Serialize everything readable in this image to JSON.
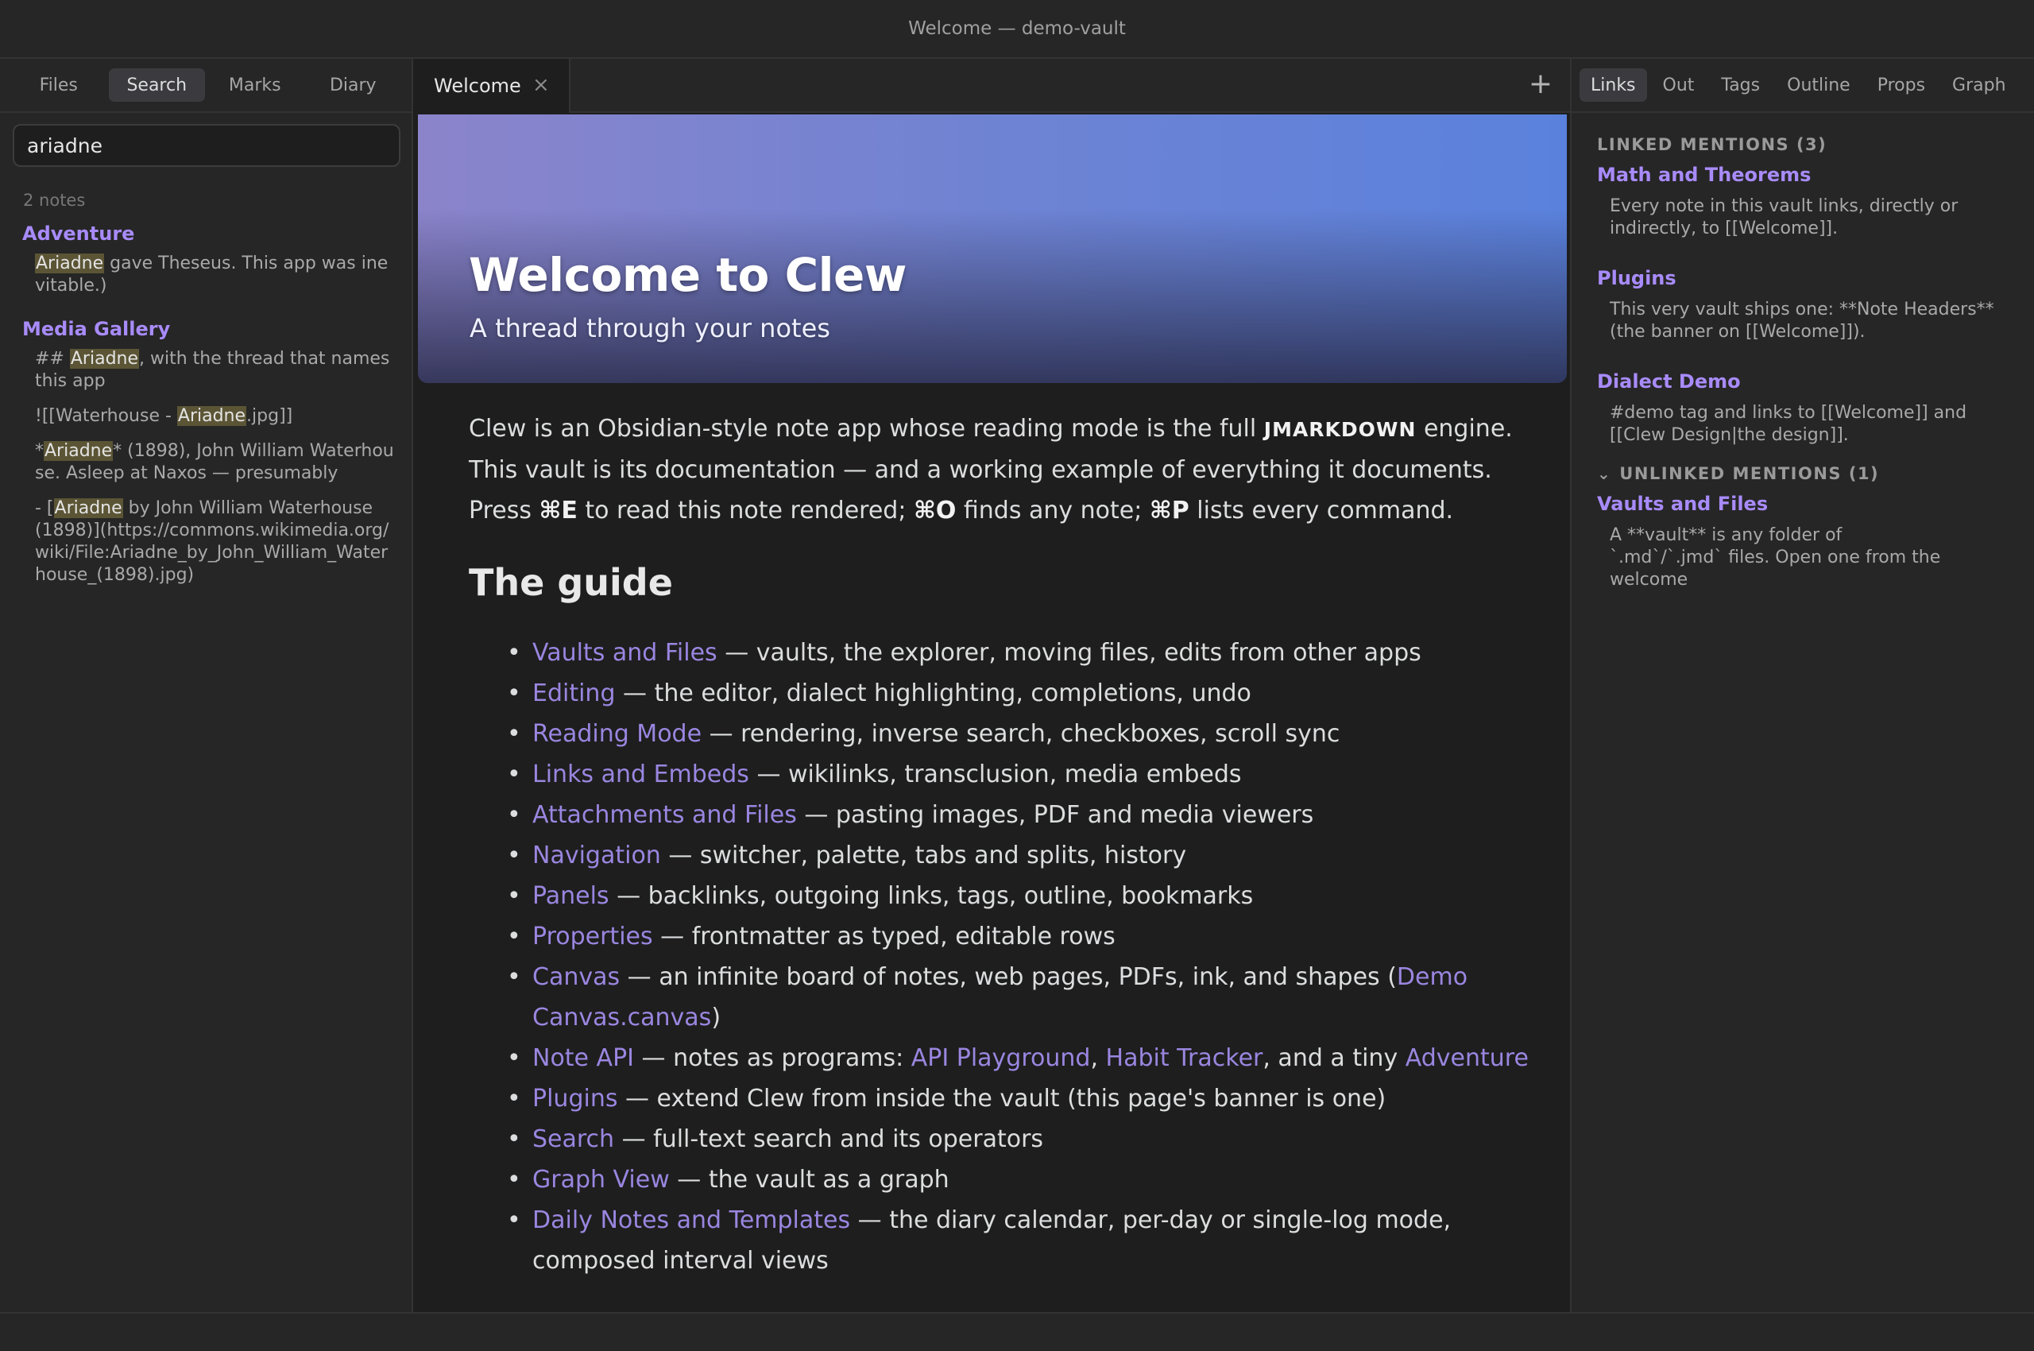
{
  "window": {
    "title": "Welcome — demo-vault"
  },
  "left_tabs": [
    "Files",
    "Search",
    "Marks",
    "Diary"
  ],
  "search": {
    "query": "ariadne",
    "count": "2 notes",
    "results": [
      {
        "file": "Adventure",
        "snippets": [
          {
            "mark": "Ariadne",
            "after": " gave Theseus. This app was inevitable.)"
          }
        ]
      },
      {
        "file": "Media Gallery",
        "snippets": [
          {
            "before": "## ",
            "mark": "Ariadne",
            "after": ", with the thread that names this app"
          },
          {
            "before": "![[Waterhouse - ",
            "mark": "Ariadne",
            "after": ".jpg]]"
          },
          {
            "before": "*",
            "mark": "Ariadne",
            "after": "* (1898), John William Waterhouse. Asleep at Naxos — presumably"
          },
          {
            "before": "- [",
            "mark": "Ariadne",
            "after": " by John William Waterhouse (1898)](https://commons.wikimedia.org/wiki/File:Ariadne_by_John_William_Waterhouse_(1898).jpg)"
          }
        ]
      }
    ]
  },
  "editor": {
    "tab_label": "Welcome",
    "close_glyph": "×",
    "new_tab_glyph": "+",
    "banner_title": "Welcome to Clew",
    "banner_subtitle": "A thread through your notes",
    "intro": {
      "p1": "Clew is an Obsidian-style note app whose reading mode is the full ",
      "engine": "JMARKDOWN",
      "p2": " engine. This vault is its documentation — and a working example of everything it documents. Press ",
      "k1": "⌘E",
      "p3": " to read this note rendered; ",
      "k2": "⌘O",
      "p4": " finds any note; ",
      "k3": "⌘P",
      "p5": " lists every command."
    },
    "guide_heading": "The guide",
    "guide": [
      {
        "link": "Vaults and Files",
        "text": " — vaults, the explorer, moving files, edits from other apps"
      },
      {
        "link": "Editing",
        "text": " — the editor, dialect highlighting, completions, undo"
      },
      {
        "link": "Reading Mode",
        "text": " — rendering, inverse search, checkboxes, scroll sync"
      },
      {
        "link": "Links and Embeds",
        "text": " — wikilinks, transclusion, media embeds"
      },
      {
        "link": "Attachments and Files",
        "text": " — pasting images, PDF and media viewers"
      },
      {
        "link": "Navigation",
        "text": " — switcher, palette, tabs and splits, history"
      },
      {
        "link": "Panels",
        "text": " — backlinks, outgoing links, tags, outline, bookmarks"
      },
      {
        "link": "Properties",
        "text": " — frontmatter as typed, editable rows"
      },
      {
        "link": "Canvas",
        "text": " — an infinite board of notes, web pages, PDFs, ink, and shapes (",
        "link2": "Demo Canvas.canvas",
        "tail": ")"
      },
      {
        "link": "Note API",
        "text": " — notes as programs: ",
        "link2": "API Playground",
        "mid": ", ",
        "link3": "Habit Tracker",
        "mid2": ", and a tiny ",
        "link4": "Adventure"
      },
      {
        "link": "Plugins",
        "text": " — extend Clew from inside the vault (this page's banner is one)"
      },
      {
        "link": "Search",
        "text": " — full-text search and its operators"
      },
      {
        "link": "Graph View",
        "text": " — the vault as a graph"
      },
      {
        "link": "Daily Notes and Templates",
        "text": " — the diary calendar, per-day or single-log mode, composed interval views"
      }
    ]
  },
  "right_tabs": [
    "Links",
    "Out",
    "Tags",
    "Outline",
    "Props",
    "Graph"
  ],
  "backlinks": {
    "linked_header": "LINKED MENTIONS (3)",
    "linked": [
      {
        "note": "Math and Theorems",
        "snippet": "Every note in this vault links, directly or indirectly, to [[Welcome]]."
      },
      {
        "note": "Plugins",
        "snippet": "This very vault ships one: **Note Headers** (the banner on [[Welcome]])."
      },
      {
        "note": "Dialect Demo",
        "snippet": "#demo tag and links to [[Welcome]] and [[Clew Design|the design]]."
      }
    ],
    "unlinked_chevron": "⌄",
    "unlinked_header": "UNLINKED MENTIONS (1)",
    "unlinked": [
      {
        "note": "Vaults and Files",
        "snippet": "A **vault** is any folder of `.md`/`.jmd` files. Open one from the welcome"
      }
    ]
  }
}
